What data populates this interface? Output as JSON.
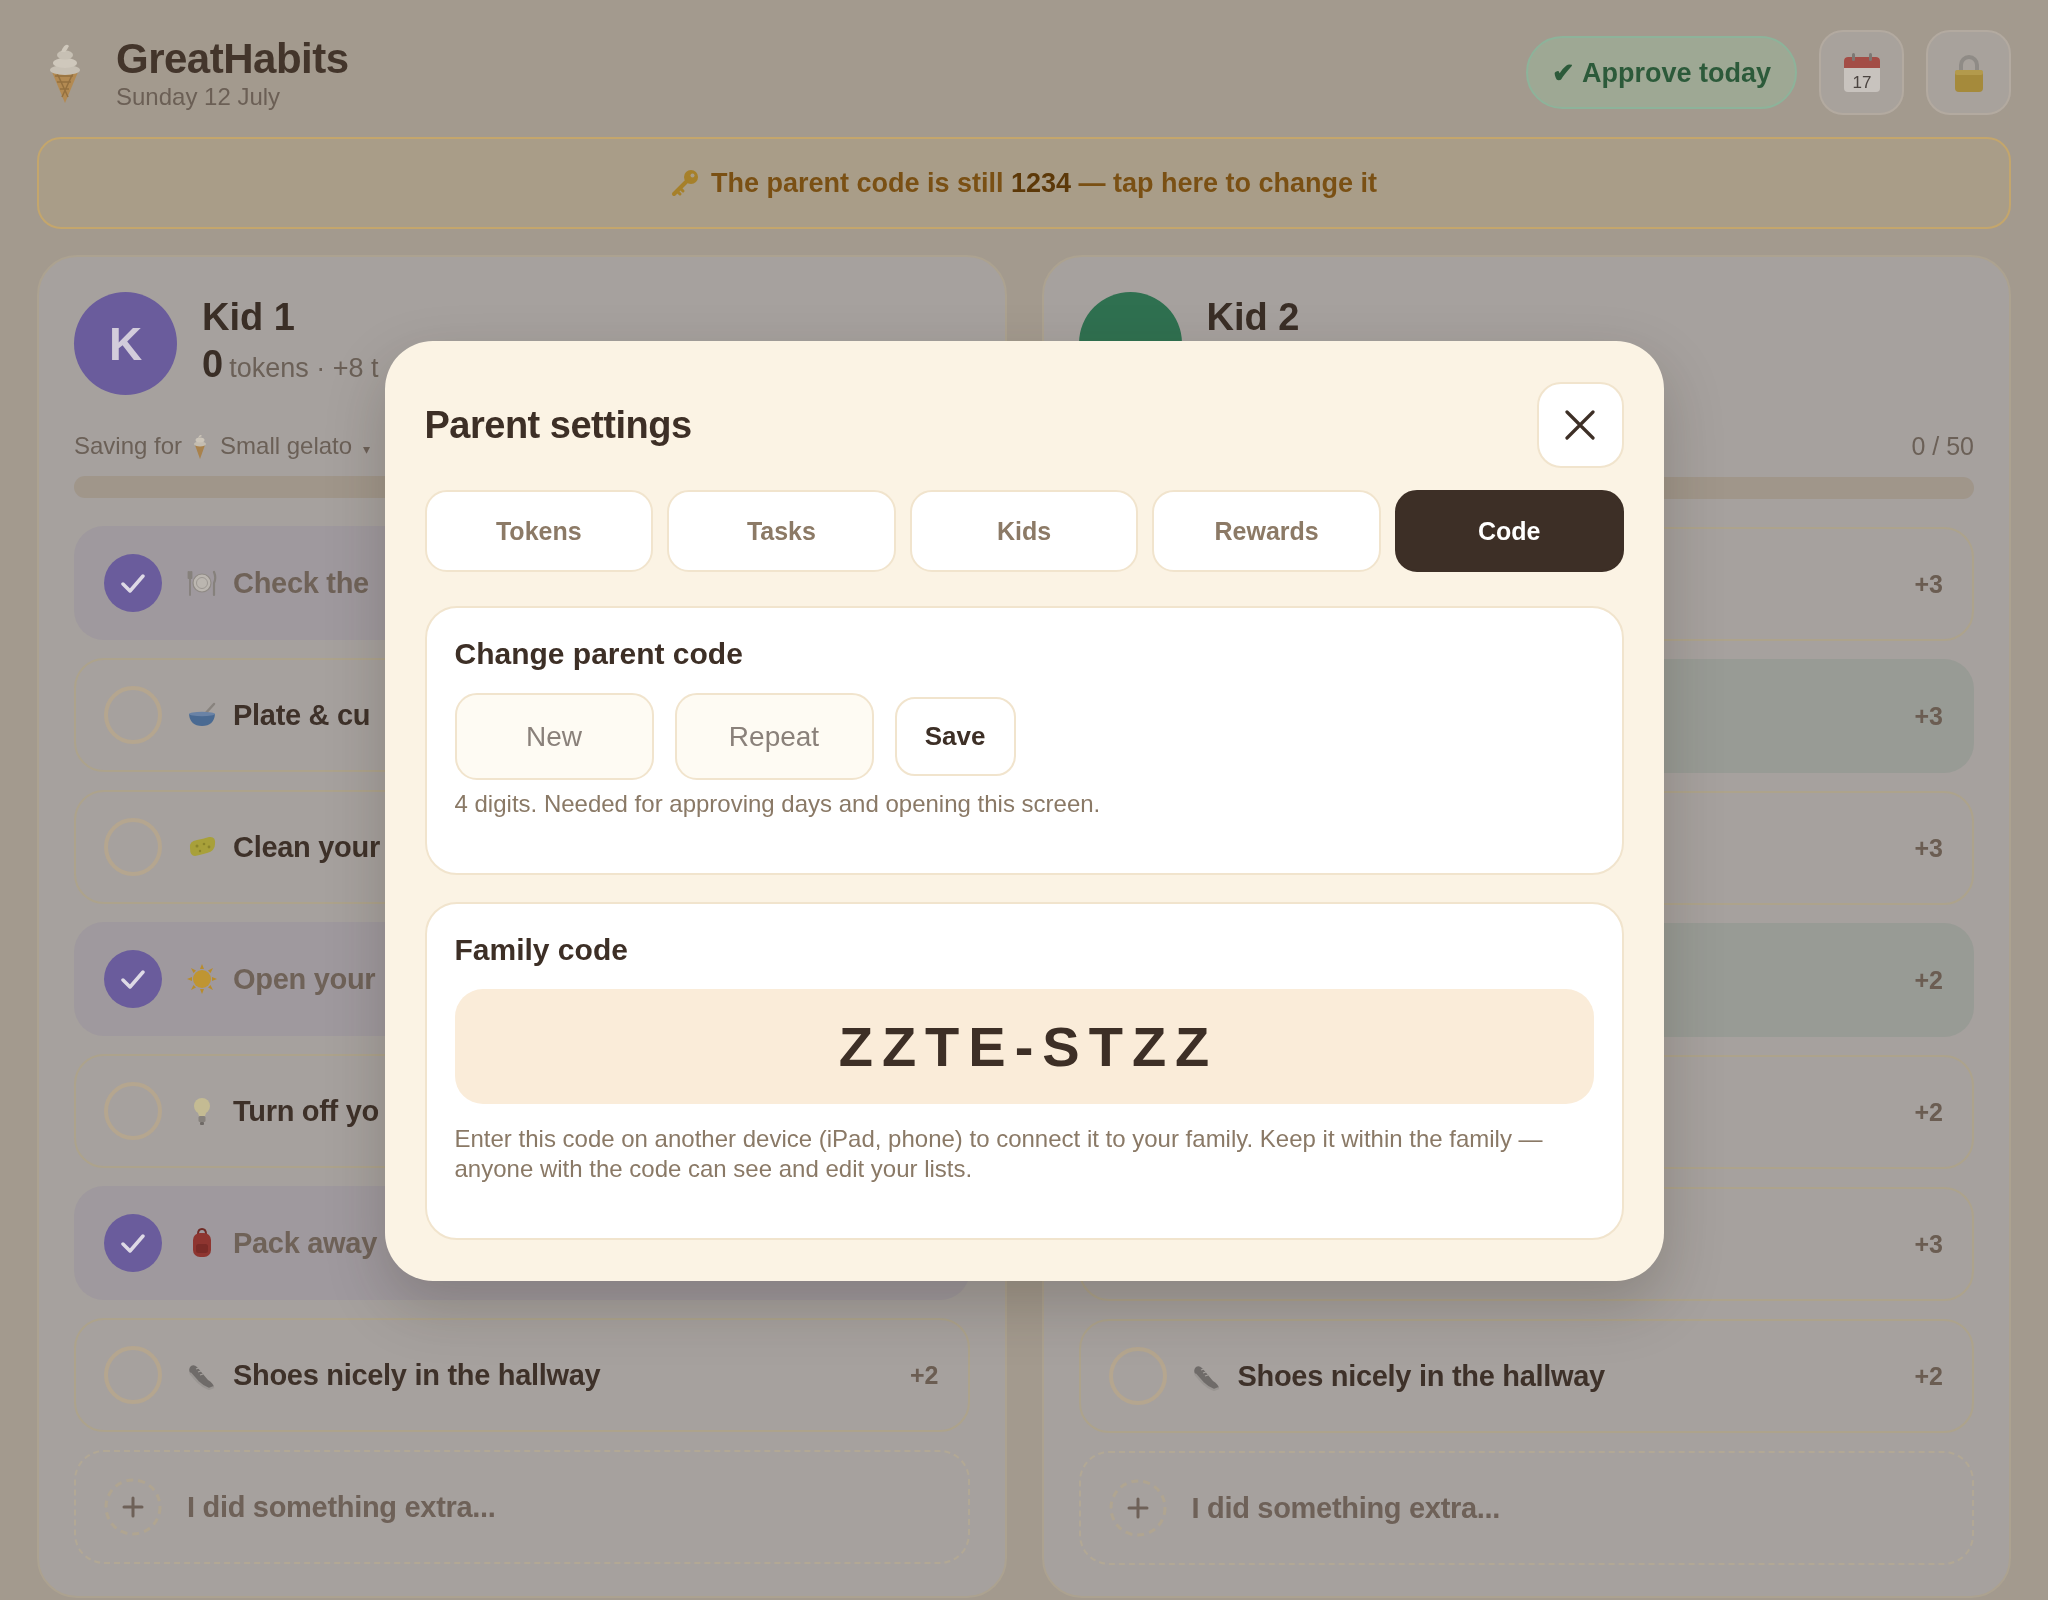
{
  "header": {
    "app_name": "GreatHabits",
    "date": "Sunday 12 July",
    "approve_button": "✔ Approve today",
    "calendar_day": "17"
  },
  "banner": {
    "text": "The parent code is still **1234** — tap here to change it"
  },
  "kids": [
    {
      "name": "Kid 1",
      "initial": "K",
      "color": "#6a5c9c",
      "tokens": "0",
      "tokens_note": "tokens · +8 t",
      "saving": {
        "label": "Saving for",
        "reward": "Small gelato",
        "caret": "▾"
      },
      "progress": {
        "level": 0
      },
      "tasks": [
        {
          "label": "Check the",
          "done": true
        },
        {
          "label": "Plate & cu",
          "done": false
        },
        {
          "label": "Clean your",
          "done": false
        },
        {
          "label": "Open your",
          "done": true
        },
        {
          "label": "Turn off yo",
          "done": false
        },
        {
          "label": "Pack away",
          "done": true
        },
        {
          "label": "Shoes nicely in the hallway",
          "points": "+2",
          "done": false
        }
      ],
      "extra_button": "I did something extra..."
    },
    {
      "name": "Kid 2",
      "color": "#2f7050",
      "progress": {
        "reading": "0 / 50",
        "level": 0
      },
      "tasks": [
        {
          "points": "+3",
          "done": false
        },
        {
          "points": "+3",
          "done": true
        },
        {
          "points": "+3",
          "done": false
        },
        {
          "points": "+2",
          "done": true
        },
        {
          "points": "+2",
          "done": false
        },
        {
          "points": "+3",
          "done": false
        },
        {
          "label": "Shoes nicely in the hallway",
          "points": "+2",
          "done": false
        }
      ],
      "extra_button": "I did something extra..."
    }
  ],
  "dialog": {
    "title": "Parent settings",
    "tabs": [
      {
        "label": "Tokens",
        "selected": false
      },
      {
        "label": "Tasks",
        "selected": false
      },
      {
        "label": "Kids",
        "selected": false
      },
      {
        "label": "Rewards",
        "selected": false
      },
      {
        "label": "Code",
        "selected": true
      }
    ],
    "parent_code": {
      "title": "Change parent code",
      "new_placeholder": "New",
      "repeat_placeholder": "Repeat",
      "save_button": "Save",
      "hint": "4 digits. Needed for approving days and opening this screen."
    },
    "family_code": {
      "title": "Family code",
      "code": "ZZTE-STZZ",
      "description": "Enter this code on another device (iPad, phone) to connect it to your family. Keep it within the family — anyone with the code can see and edit your lists."
    }
  }
}
